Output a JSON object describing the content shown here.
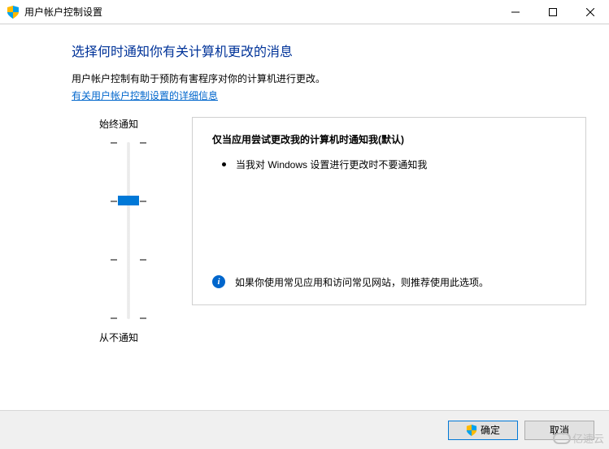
{
  "window": {
    "title": "用户帐户控制设置"
  },
  "main": {
    "heading": "选择何时通知你有关计算机更改的消息",
    "description": "用户帐户控制有助于预防有害程序对你的计算机进行更改。",
    "link": "有关用户帐户控制设置的详细信息"
  },
  "slider": {
    "topLabel": "始终通知",
    "bottomLabel": "从不通知",
    "levels": 4,
    "current": 1
  },
  "detail": {
    "title": "仅当应用尝试更改我的计算机时通知我(默认)",
    "bullet": "当我对 Windows 设置进行更改时不要通知我",
    "infoText": "如果你使用常见应用和访问常见网站，则推荐使用此选项。"
  },
  "footer": {
    "ok": "确定",
    "cancel": "取消"
  },
  "watermark": "亿速云"
}
